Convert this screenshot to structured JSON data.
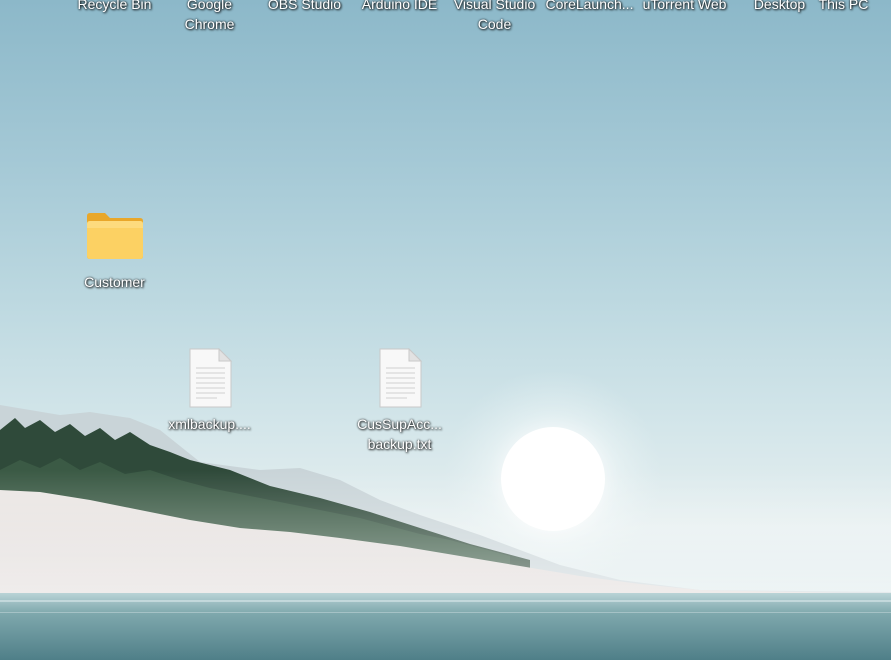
{
  "desktop": {
    "top_icons": [
      {
        "label": "Recycle Bin"
      },
      {
        "label": "Google Chrome"
      },
      {
        "label": "OBS Studio"
      },
      {
        "label": "Arduino IDE"
      },
      {
        "label": "Visual Studio Code"
      },
      {
        "label": "CoreLaunch..."
      },
      {
        "label": "uTorrent Web"
      },
      {
        "label": "Desktop"
      },
      {
        "label": "This PC"
      }
    ],
    "folder": {
      "label": "Customer",
      "icon": "folder-icon"
    },
    "files": [
      {
        "label": "xmlbackup....",
        "icon": "text-file-icon"
      },
      {
        "label": "CusSupAcc...backup.txt",
        "line1": "CusSupAcc...",
        "line2": "backup.txt",
        "icon": "text-file-icon"
      }
    ]
  },
  "colors": {
    "sky_top": "#8cb8c9",
    "sky_mid": "#bcd8e0",
    "water": "#5f8f98",
    "folder": "#f7c948",
    "label_text": "#ffffff"
  }
}
